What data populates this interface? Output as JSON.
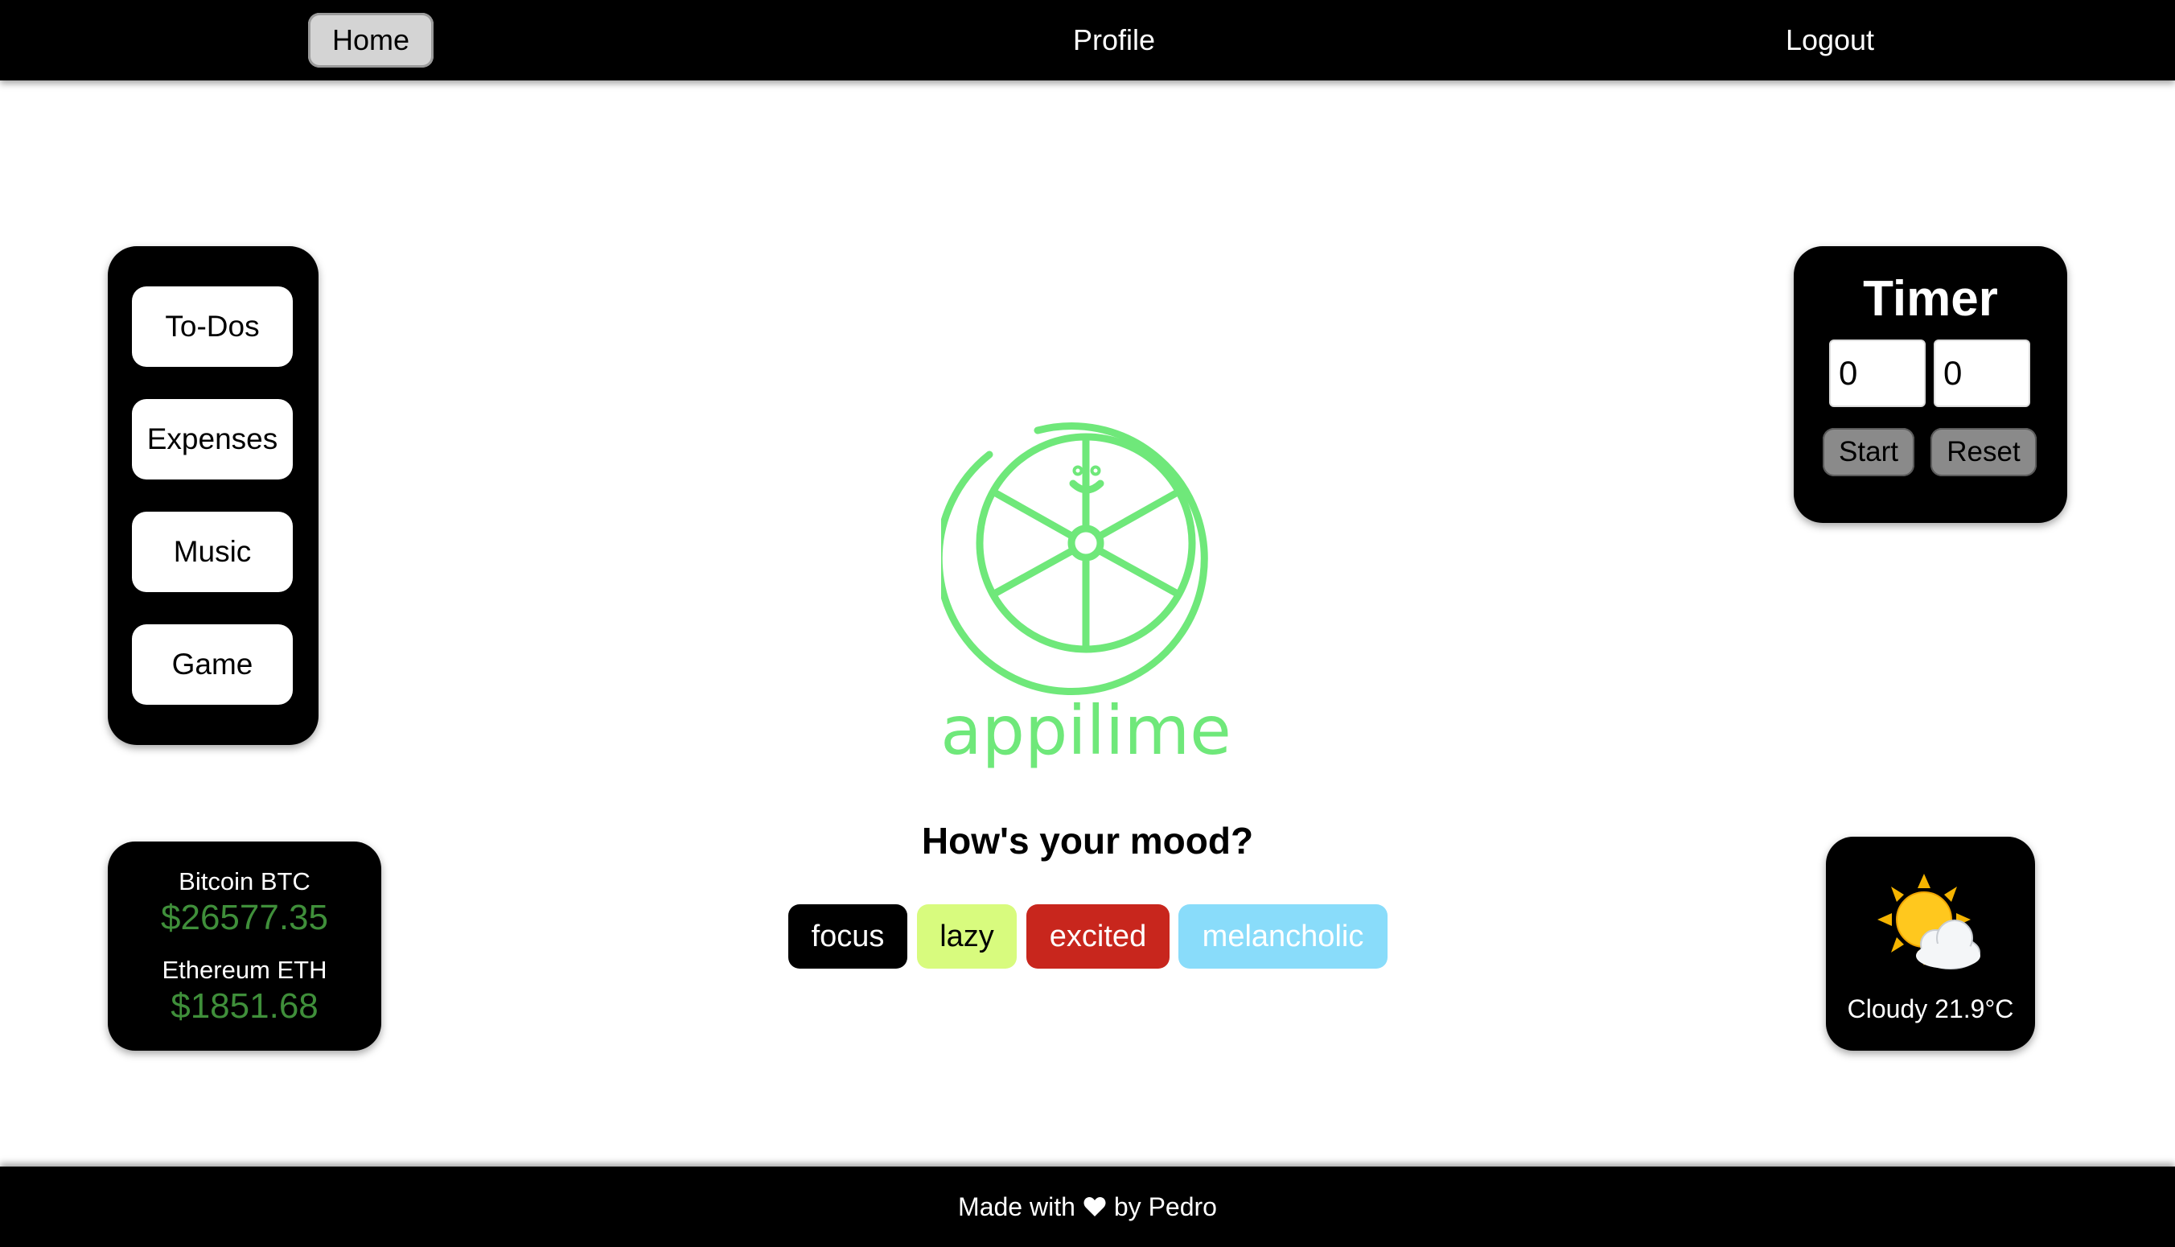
{
  "nav": {
    "home": "Home",
    "profile": "Profile",
    "logout": "Logout"
  },
  "menu": {
    "items": [
      "To-Dos",
      "Expenses",
      "Music",
      "Game"
    ]
  },
  "crypto": {
    "coins": [
      {
        "name": "Bitcoin BTC",
        "price": "$26577.35"
      },
      {
        "name": "Ethereum ETH",
        "price": "$1851.68"
      }
    ],
    "price_color": "#3f8f3a"
  },
  "logo": {
    "text": "appilime",
    "color": "#6fe87a"
  },
  "mood": {
    "title": "How's your mood?",
    "options": [
      {
        "label": "focus",
        "bg": "#000000",
        "fg": "#ffffff"
      },
      {
        "label": "lazy",
        "bg": "#d8fb7e",
        "fg": "#000000"
      },
      {
        "label": "excited",
        "bg": "#c8261d",
        "fg": "#ffffff"
      },
      {
        "label": "melancholic",
        "bg": "#89dcfa",
        "fg": "#ffffff"
      }
    ]
  },
  "timer": {
    "title": "Timer",
    "minutes": "0",
    "seconds": "0",
    "start_label": "Start",
    "reset_label": "Reset"
  },
  "weather": {
    "icon": "sun-behind-cloud-icon",
    "text": "Cloudy 21.9°C"
  },
  "footer": {
    "prefix": "Made with",
    "icon": "heart-icon",
    "suffix": "by Pedro"
  }
}
